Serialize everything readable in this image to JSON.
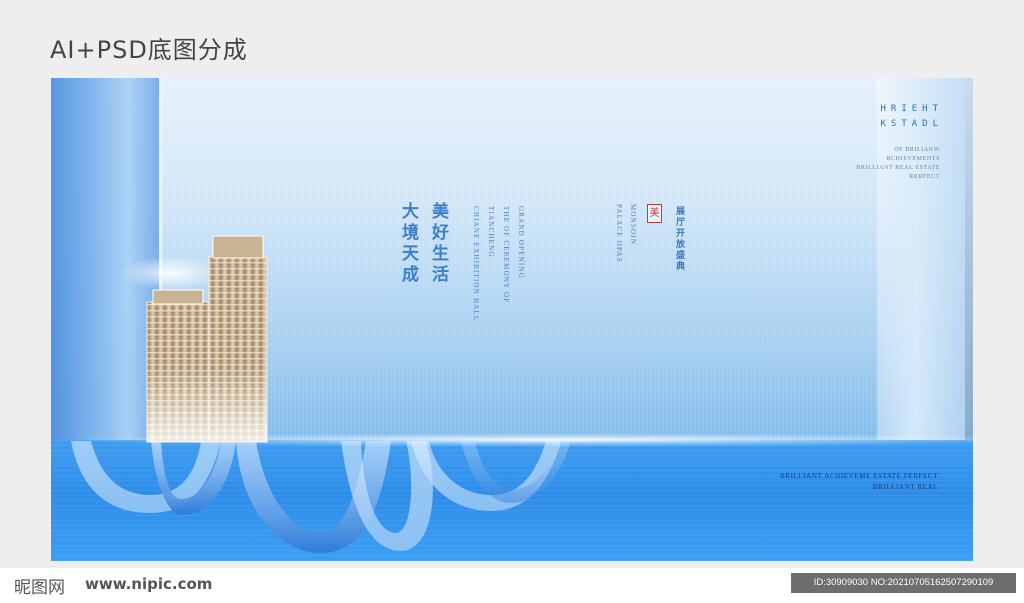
{
  "header": {
    "title": "AI+PSD底图分成"
  },
  "poster": {
    "cn_main": "大境天成",
    "cn_main2": "美好生活",
    "en_col1": "GRAND OPENING",
    "en_col2": "THE OF CEREMONY OF",
    "en_col3": "TIANCHENG",
    "en_col4": "CHIANE EXHIBITION HALL",
    "en_col5": "MONSOIN",
    "en_col6": "PALACE OPAS",
    "seal": "美",
    "cn_side": "展厅开放盛典",
    "brand": {
      "line1": "HRIEHT",
      "line2": "KSTADL"
    },
    "brand_sub": [
      "OF BRILIANW",
      "BCHIEVEMENTS",
      "BRILLIANT REAL ESTATE",
      "RRRFECT"
    ],
    "bottom": [
      "BRILLIANT ACHIEVEME  ESTATE PERFECT",
      "BRILLIANT REAL"
    ]
  },
  "watermark": {
    "logo": "昵图网",
    "site": "www.nipic.com",
    "id": "ID:30909030 NO:20210705162507290109"
  },
  "colors": {
    "accent": "#3a7fc8",
    "seal_red": "#c23b3b",
    "water": "#2e8de9"
  }
}
